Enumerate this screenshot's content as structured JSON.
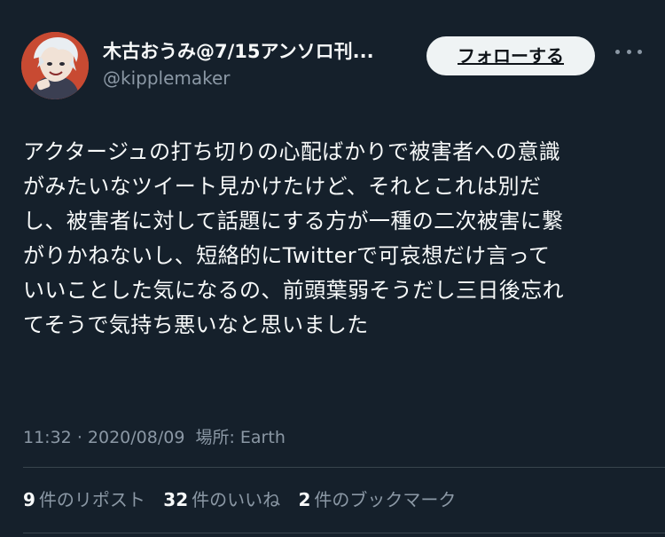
{
  "author": {
    "display_name": "木古おうみ@7/15アンソロ刊...",
    "handle": "@kipplemaker",
    "avatar_icon": "avatar-illustration-icon"
  },
  "follow_button": {
    "label": "フォローする"
  },
  "more_icon": "more-options-icon",
  "tweet": {
    "text": "アクタージュの打ち切りの心配ばかりで被害者への意識\nがみたいなツイート見かけたけど、それとこれは別だ\nし、被害者に対して話題にする方が一種の二次被害に繋\nがりかねないし、短絡的にTwitterで可哀想だけ言って\nいいことした気になるの、前頭葉弱そうだし三日後忘れ\nてそうで気持ち悪いなと思いました"
  },
  "meta": {
    "time": "11:32",
    "separator": "·",
    "date": "2020/08/09",
    "location_label": "場所: Earth"
  },
  "stats": {
    "reposts": {
      "count": "9",
      "label": "件のリポスト"
    },
    "likes": {
      "count": "32",
      "label": "件のいいね"
    },
    "bookmarks": {
      "count": "2",
      "label": "件のブックマーク"
    }
  },
  "colors": {
    "background": "#15202b",
    "text_primary": "#f7f9f9",
    "text_secondary": "#8b98a5",
    "divider": "#38444d",
    "follow_button_bg": "#eff3f4"
  }
}
